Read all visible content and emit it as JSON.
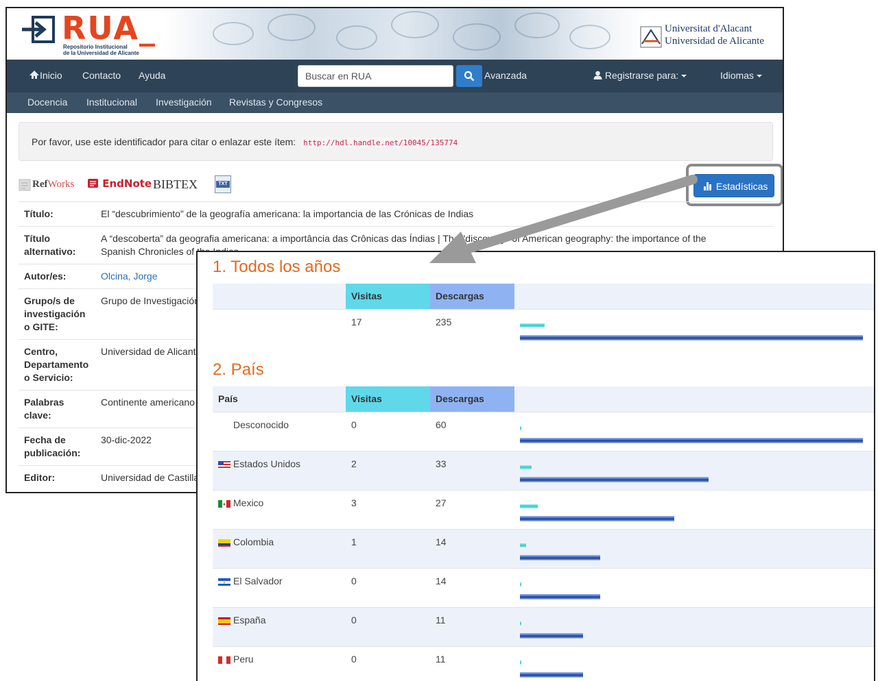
{
  "logo": {
    "wordmark": "RUA_",
    "subtitle_line1": "Repositorio Institucional",
    "subtitle_line2": "de la Universidad de Alicante"
  },
  "university": {
    "name_line1": "Universitat d'Alacant",
    "name_line2": "Universidad de Alicante"
  },
  "navbar": {
    "home": "Inicio",
    "contact": "Contacto",
    "help": "Ayuda",
    "search_placeholder": "Buscar en RUA",
    "advanced": "Avanzada",
    "register": "Registrarse para:",
    "languages": "Idiomas"
  },
  "subnav": [
    "Docencia",
    "Institucional",
    "Investigación",
    "Revistas y Congresos"
  ],
  "cite": {
    "text": "Por favor, use este identificador para citar o enlazar este ítem:",
    "url": "http://hdl.handle.net/10045/135774"
  },
  "export": {
    "refworks_ref": "Ref",
    "refworks_works": "Works",
    "endnote": "EndNote",
    "bibtex": "BIBTEX",
    "txt": "TXT"
  },
  "stats_button": "Estadísticas",
  "metadata": [
    {
      "label": "Título:",
      "value": "El “descubrimiento” de la geografía americana: la importancia de las Crónicas de Indias"
    },
    {
      "label": "Título alternativo:",
      "value": "A “descoberta” da geografia americana: a importância das Crônicas das Índias | The \"discovery\" of American geography: the importance of the Spanish Chronicles of the Indies"
    },
    {
      "label": "Autor/es:",
      "value": "Olcina, Jorge"
    },
    {
      "label": "Grupo/s de investigación o GITE:",
      "value": "Grupo de Investigación"
    },
    {
      "label": "Centro, Departamento o Servicio:",
      "value": "Universidad de Alicante"
    },
    {
      "label": "Palabras clave:",
      "value": "Continente americano |"
    },
    {
      "label": "Fecha de publicación:",
      "value": "30-dic-2022"
    },
    {
      "label": "Editor:",
      "value": "Universidad de Castilla"
    }
  ],
  "stats": {
    "section1_title": "1. Todos los años",
    "section2_title": "2. País",
    "headers": {
      "country": "País",
      "visits": "Visitas",
      "downloads": "Descargas"
    },
    "colors": {
      "visits_header": "#5fd9e9",
      "downloads_header": "#8fb3f2",
      "title": "#e36a1e"
    },
    "totals": {
      "visits": 17,
      "downloads": 235
    },
    "countries": [
      {
        "name": "Desconocido",
        "flag": "none",
        "visits": 0,
        "downloads": 60
      },
      {
        "name": "Estados Unidos",
        "flag": "us-flag",
        "visits": 2,
        "downloads": 33
      },
      {
        "name": "Mexico",
        "flag": "mexico-flag",
        "visits": 3,
        "downloads": 27
      },
      {
        "name": "Colombia",
        "flag": "colombia-flag",
        "visits": 1,
        "downloads": 14
      },
      {
        "name": "El Salvador",
        "flag": "el-salvador-flag",
        "visits": 0,
        "downloads": 14
      },
      {
        "name": "España",
        "flag": "spain-flag",
        "visits": 0,
        "downloads": 11
      },
      {
        "name": "Peru",
        "flag": "peru-flag",
        "visits": 0,
        "downloads": 11
      }
    ]
  }
}
